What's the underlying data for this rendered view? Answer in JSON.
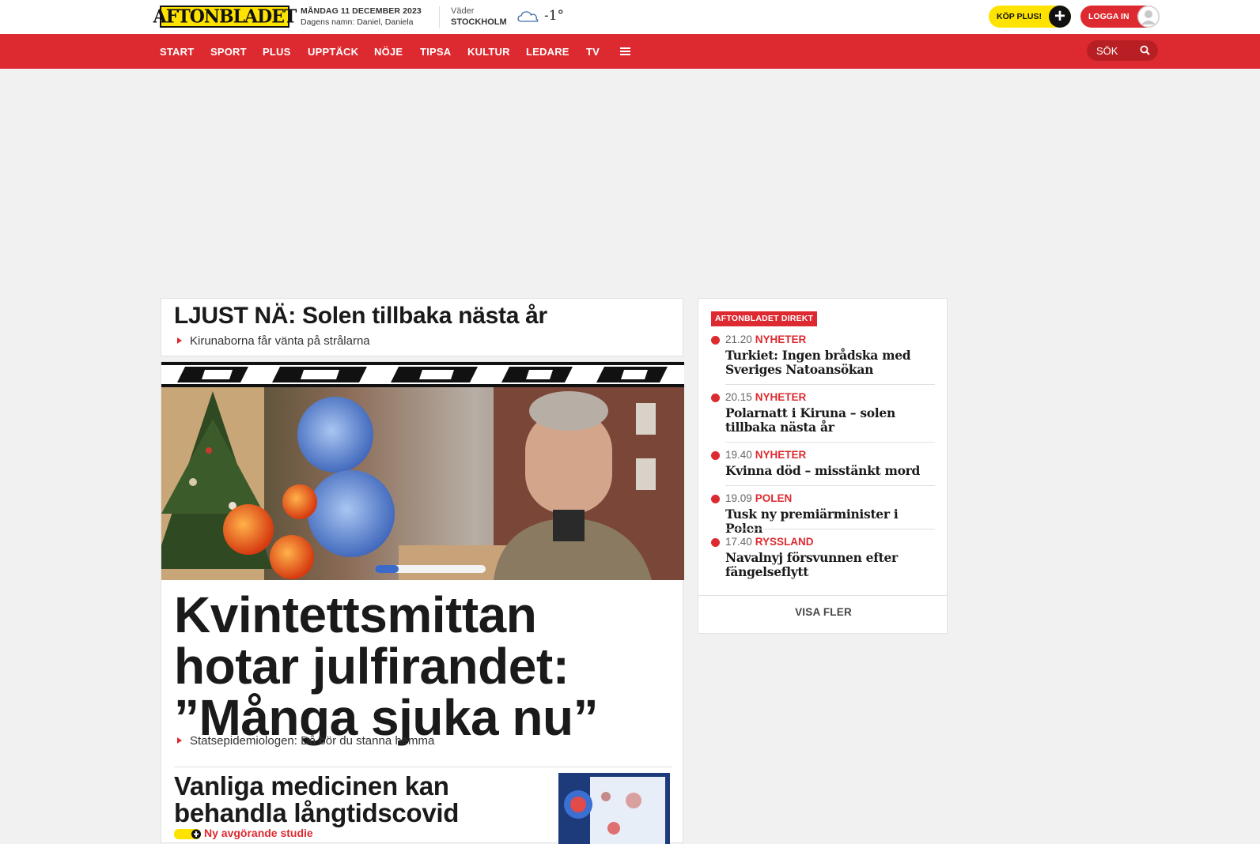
{
  "header": {
    "logo": "AFTONBLADET",
    "date": "MÅNDAG 11 DECEMBER 2023",
    "name_day": "Dagens namn: Daniel, Daniela",
    "weather_label": "Väder",
    "weather_city": "STOCKHOLM",
    "temperature": "-1°",
    "buy_plus": "KÖP PLUS!",
    "login": "LOGGA IN"
  },
  "nav": {
    "items": [
      "START",
      "SPORT",
      "PLUS",
      "UPPTÄCK",
      "NÖJE",
      "TIPSA",
      "KULTUR",
      "LEDARE",
      "TV"
    ],
    "search_label": "SÖK"
  },
  "teaser": {
    "title": "LJUST NÄ: Solen tillbaka nästa år",
    "sub": "Kirunaborna får vänta på strålarna"
  },
  "main_story": {
    "banner": "EXTRA",
    "headline": "Kvintettsmittan hotar julfirandet: ”Många sjuka nu”",
    "sub": "Statsepidemiologen: Då bör du stanna hemma"
  },
  "second_story": {
    "headline": "Vanliga medicinen kan behandla långtidscovid",
    "tag": "Ny avgörande studie"
  },
  "direkt": {
    "badge": "AFTONBLADET DIREKT",
    "items": [
      {
        "time": "21.20",
        "category": "NYHETER",
        "headline": "Turkiet: Ingen brådska med Sveriges Natoansökan"
      },
      {
        "time": "20.15",
        "category": "NYHETER",
        "headline": "Polarnatt i Kiruna – solen tillbaka nästa år"
      },
      {
        "time": "19.40",
        "category": "NYHETER",
        "headline": "Kvinna död – misstänkt mord"
      },
      {
        "time": "19.09",
        "category": "POLEN",
        "headline": "Tusk ny premiärminister i Polen"
      },
      {
        "time": "17.40",
        "category": "RYSSLAND",
        "headline": "Navalnyj försvunnen efter fängelseflytt"
      }
    ],
    "more": "VISA FLER"
  },
  "colors": {
    "brand_red": "#dd2a30",
    "brand_yellow": "#ffe300",
    "background": "#f1f1f1"
  }
}
